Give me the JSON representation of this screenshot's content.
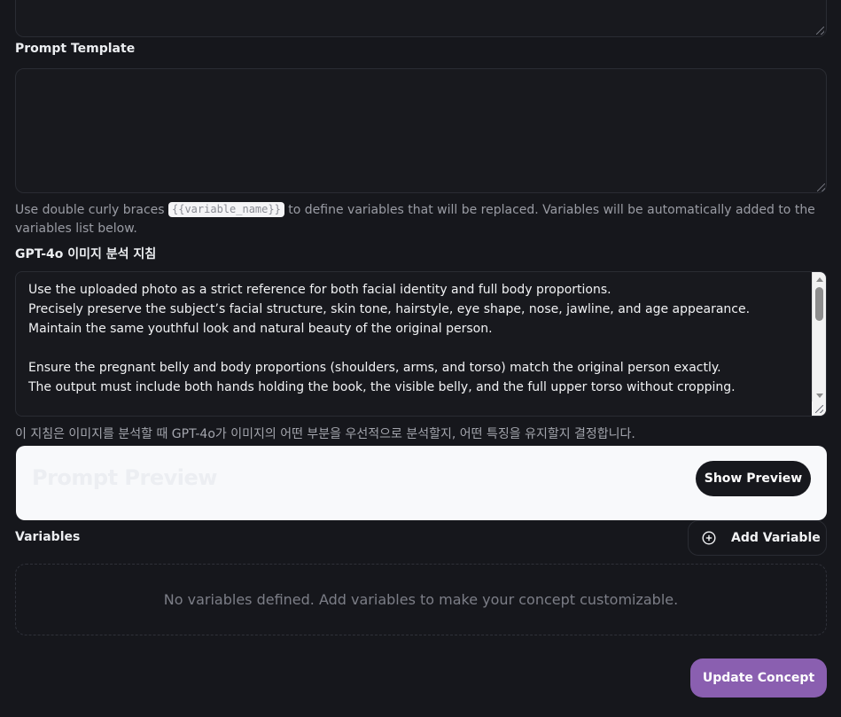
{
  "prompt_template": {
    "label": "Prompt Template",
    "value": "",
    "help_before": "Use double curly braces ",
    "help_code": "{{variable_name}}",
    "help_after": " to define variables that will be replaced. Variables will be automatically added to the variables list below."
  },
  "gpt_instructions": {
    "label": "GPT-4o 이미지 분석 지침",
    "value": "Use the uploaded photo as a strict reference for both facial identity and full body proportions.\nPrecisely preserve the subject’s facial structure, skin tone, hairstyle, eye shape, nose, jawline, and age appearance.\nMaintain the same youthful look and natural beauty of the original person.\n\nEnsure the pregnant belly and body proportions (shoulders, arms, and torso) match the original person exactly.\nThe output must include both hands holding the book, the visible belly, and the full upper torso without cropping.",
    "help": "이 지침은 이미지를 분석할 때 GPT-4o가 이미지의 어떤 부분을 우선적으로 분석할지, 어떤 특징을 유지할지 결정합니다."
  },
  "preview": {
    "title": "Prompt Preview",
    "button_label": "Show Preview"
  },
  "variables": {
    "label": "Variables",
    "add_button_label": "Add Variable",
    "empty_message": "No variables defined. Add variables to make your concept customizable."
  },
  "footer": {
    "update_button_label": "Update Concept"
  },
  "colors": {
    "background": "#16171c",
    "accent": "#8a5fb0",
    "card": "#f8f9fb"
  }
}
